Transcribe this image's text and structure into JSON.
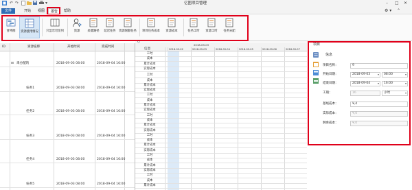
{
  "app": {
    "title": "亿图项目管理"
  },
  "menu": {
    "items": [
      "文件",
      "开始",
      "视图",
      "报告",
      "帮助"
    ]
  },
  "ribbon": {
    "buttons": [
      "甘特图",
      "资源使用情况",
      "只显示可见列",
      "资源",
      "关键路径",
      "延迟任务",
      "资源限额任务",
      "项目任务成本",
      "资源成本",
      "任务工时",
      "资源工时",
      "任务分配"
    ]
  },
  "table": {
    "headers": [
      "ID",
      "资源名称",
      "开始时间",
      "完成时间"
    ],
    "rows": [
      {
        "name": "未分配的",
        "start": "2018-09-03 08:00",
        "end": "2018-09-04 16:00",
        "group": true
      },
      {
        "name": "任务1",
        "start": "2018-09-03 08:00",
        "end": "2018-09-04 16:00"
      },
      {
        "name": "任务2",
        "start": "2018-09-03 08:00",
        "end": "2018-09-04 16:00"
      },
      {
        "name": "任务3",
        "start": "2018-09-03 08:00",
        "end": "2018-09-04 16:00"
      },
      {
        "name": "任务4",
        "start": "2018-09-03 08:00",
        "end": "2018-09-04 16:00"
      },
      {
        "name": "任务5",
        "start": "2018-09-03 08:00",
        "end": "2018-09-04 16:00"
      }
    ]
  },
  "gantt": {
    "label_header": "信息",
    "week_label": "2018-09-03",
    "dates": [
      "2018-09-02",
      "2018-09-03",
      "2018-09-04",
      "2018-09-05",
      "2018-09-06",
      "2018-09-07"
    ],
    "row_labels": [
      "工时",
      "成本",
      "累计成本",
      "实际成本"
    ]
  },
  "panel": {
    "title": "项目",
    "section": "信息",
    "fields": [
      {
        "label": "项目名称：",
        "value": "9"
      },
      {
        "label": "开始日期：",
        "value": "2018-09-03",
        "time": "08:00"
      },
      {
        "label": "结束日期：",
        "value": "2018-09-04",
        "time": "16:00"
      },
      {
        "label": "工期：",
        "value": "16",
        "unit": "小时"
      },
      {
        "label": "基线成本：",
        "value": "¥,4"
      },
      {
        "label": "实际成本：",
        "value": "¥,0"
      },
      {
        "label": "剩余成本：",
        "value": "¥,0"
      }
    ]
  },
  "colors": {
    "accent": "#2f6db5",
    "highlight": "#e0001a",
    "today_column": "#dceaf8"
  }
}
